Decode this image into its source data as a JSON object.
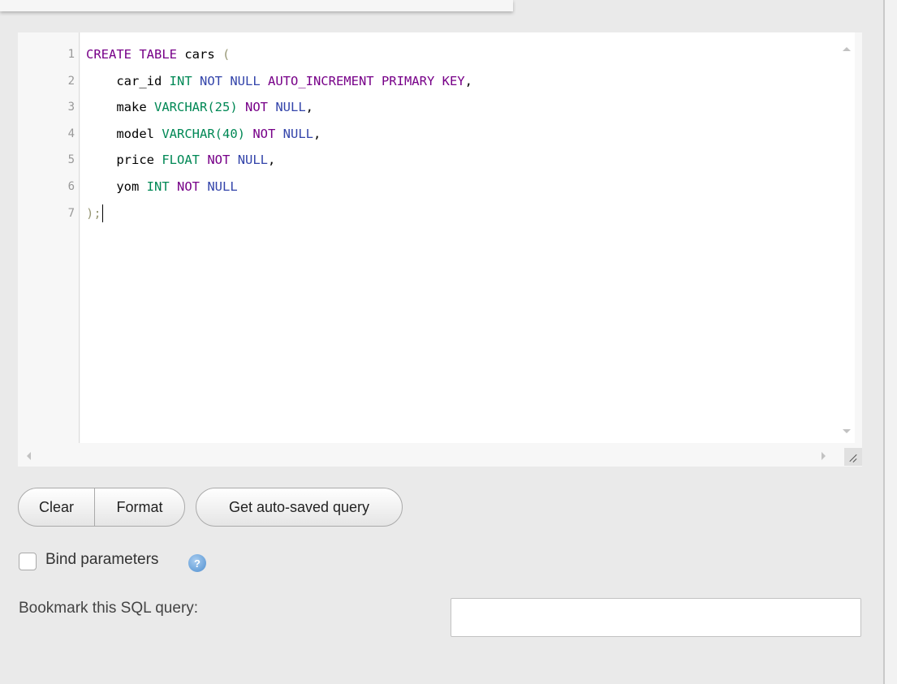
{
  "editor": {
    "lines": [
      {
        "num": "1",
        "tokens": [
          {
            "t": "CREATE",
            "c": "#770088"
          },
          {
            "t": " ",
            "c": "#000"
          },
          {
            "t": "TABLE",
            "c": "#770088"
          },
          {
            "t": " cars ",
            "c": "#000000"
          },
          {
            "t": "(",
            "c": "#999977"
          }
        ]
      },
      {
        "num": "2",
        "tokens": [
          {
            "t": "    car_id ",
            "c": "#000000"
          },
          {
            "t": "INT",
            "c": "#008855"
          },
          {
            "t": " ",
            "c": "#000"
          },
          {
            "t": "NOT NULL",
            "c": "#3344aa"
          },
          {
            "t": " AUTO_INCREMENT PRIMARY KEY",
            "c": "#770088"
          },
          {
            "t": ",",
            "c": "#000000"
          }
        ]
      },
      {
        "num": "3",
        "tokens": [
          {
            "t": "    make ",
            "c": "#000000"
          },
          {
            "t": "VARCHAR(25)",
            "c": "#008855"
          },
          {
            "t": " ",
            "c": "#000"
          },
          {
            "t": "NOT",
            "c": "#770088"
          },
          {
            "t": " ",
            "c": "#000"
          },
          {
            "t": "NULL",
            "c": "#3344aa"
          },
          {
            "t": ",",
            "c": "#000000"
          }
        ]
      },
      {
        "num": "4",
        "tokens": [
          {
            "t": "    model ",
            "c": "#000000"
          },
          {
            "t": "VARCHAR(40)",
            "c": "#008855"
          },
          {
            "t": " ",
            "c": "#000"
          },
          {
            "t": "NOT",
            "c": "#770088"
          },
          {
            "t": " ",
            "c": "#000"
          },
          {
            "t": "NULL",
            "c": "#3344aa"
          },
          {
            "t": ",",
            "c": "#000000"
          }
        ]
      },
      {
        "num": "5",
        "tokens": [
          {
            "t": "    price ",
            "c": "#000000"
          },
          {
            "t": "FLOAT",
            "c": "#008855"
          },
          {
            "t": " ",
            "c": "#000"
          },
          {
            "t": "NOT",
            "c": "#770088"
          },
          {
            "t": " ",
            "c": "#000"
          },
          {
            "t": "NULL",
            "c": "#3344aa"
          },
          {
            "t": ",",
            "c": "#000000"
          }
        ]
      },
      {
        "num": "6",
        "tokens": [
          {
            "t": "    yom ",
            "c": "#000000"
          },
          {
            "t": "INT",
            "c": "#008855"
          },
          {
            "t": " ",
            "c": "#000"
          },
          {
            "t": "NOT",
            "c": "#770088"
          },
          {
            "t": " ",
            "c": "#000"
          },
          {
            "t": "NULL",
            "c": "#3344aa"
          }
        ]
      },
      {
        "num": "7",
        "tokens": [
          {
            "t": ");",
            "c": "#999977"
          }
        ],
        "cursor": true
      }
    ]
  },
  "buttons": {
    "clear": "Clear",
    "format": "Format",
    "auto_saved": "Get auto-saved query"
  },
  "bind_parameters": {
    "label": "Bind parameters",
    "checked": false,
    "help_glyph": "?"
  },
  "bookmark": {
    "label": "Bookmark this SQL query:",
    "value": ""
  }
}
